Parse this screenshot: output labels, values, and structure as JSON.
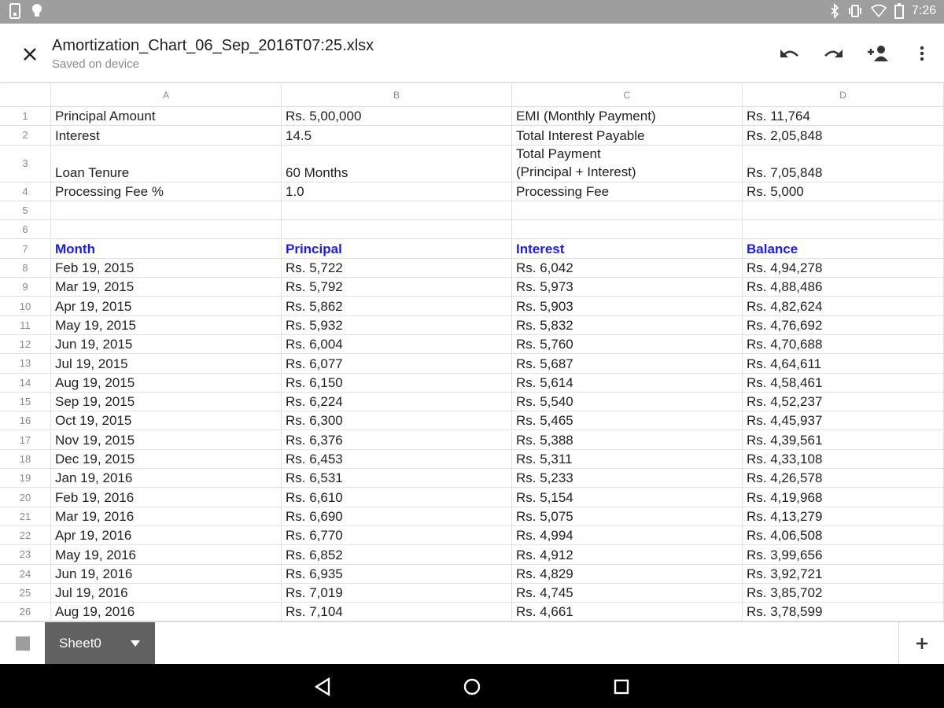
{
  "status_bar": {
    "time": "7:26",
    "left_icons": [
      "sim-icon",
      "lightbulb-icon"
    ],
    "right_icons": [
      "bluetooth-icon",
      "vibrate-icon",
      "wifi-icon",
      "battery-icon"
    ]
  },
  "app_bar": {
    "title": "Amortization_Chart_06_Sep_2016T07:25.xlsx",
    "subtitle": "Saved on device",
    "actions": [
      "undo-icon",
      "redo-icon",
      "add-person-icon",
      "more-vert-icon"
    ]
  },
  "columns": [
    "A",
    "B",
    "C",
    "D"
  ],
  "rows": [
    {
      "num": "1",
      "cells": [
        "Principal Amount",
        "Rs. 5,00,000",
        "EMI (Monthly Payment)",
        "Rs. 11,764"
      ]
    },
    {
      "num": "2",
      "cells": [
        "Interest",
        "14.5",
        "Total Interest Payable",
        "Rs. 2,05,848"
      ]
    },
    {
      "num": "3",
      "cells": [
        "Loan Tenure",
        "60 Months",
        "Total Payment",
        "Rs. 7,05,848"
      ],
      "c_line2": "(Principal + Interest)"
    },
    {
      "num": "4",
      "cells": [
        "Processing Fee %",
        "1.0",
        "Processing Fee",
        "Rs. 5,000"
      ]
    },
    {
      "num": "5",
      "cells": [
        "",
        "",
        "",
        ""
      ]
    },
    {
      "num": "6",
      "cells": [
        "",
        "",
        "",
        ""
      ]
    },
    {
      "num": "7",
      "cells": [
        "Month",
        "Principal",
        "Interest",
        "Balance"
      ],
      "header": true
    },
    {
      "num": "8",
      "cells": [
        "Feb 19, 2015",
        "Rs. 5,722",
        "Rs. 6,042",
        "Rs. 4,94,278"
      ]
    },
    {
      "num": "9",
      "cells": [
        "Mar 19, 2015",
        "Rs. 5,792",
        "Rs. 5,973",
        "Rs. 4,88,486"
      ]
    },
    {
      "num": "10",
      "cells": [
        "Apr 19, 2015",
        "Rs. 5,862",
        "Rs. 5,903",
        "Rs. 4,82,624"
      ]
    },
    {
      "num": "11",
      "cells": [
        "May 19, 2015",
        "Rs. 5,932",
        "Rs. 5,832",
        "Rs. 4,76,692"
      ]
    },
    {
      "num": "12",
      "cells": [
        "Jun 19, 2015",
        "Rs. 6,004",
        "Rs. 5,760",
        "Rs. 4,70,688"
      ]
    },
    {
      "num": "13",
      "cells": [
        "Jul 19, 2015",
        "Rs. 6,077",
        "Rs. 5,687",
        "Rs. 4,64,611"
      ]
    },
    {
      "num": "14",
      "cells": [
        "Aug 19, 2015",
        "Rs. 6,150",
        "Rs. 5,614",
        "Rs. 4,58,461"
      ]
    },
    {
      "num": "15",
      "cells": [
        "Sep 19, 2015",
        "Rs. 6,224",
        "Rs. 5,540",
        "Rs. 4,52,237"
      ]
    },
    {
      "num": "16",
      "cells": [
        "Oct 19, 2015",
        "Rs. 6,300",
        "Rs. 5,465",
        "Rs. 4,45,937"
      ]
    },
    {
      "num": "17",
      "cells": [
        "Nov 19, 2015",
        "Rs. 6,376",
        "Rs. 5,388",
        "Rs. 4,39,561"
      ]
    },
    {
      "num": "18",
      "cells": [
        "Dec 19, 2015",
        "Rs. 6,453",
        "Rs. 5,311",
        "Rs. 4,33,108"
      ]
    },
    {
      "num": "19",
      "cells": [
        "Jan 19, 2016",
        "Rs. 6,531",
        "Rs. 5,233",
        "Rs. 4,26,578"
      ]
    },
    {
      "num": "20",
      "cells": [
        "Feb 19, 2016",
        "Rs. 6,610",
        "Rs. 5,154",
        "Rs. 4,19,968"
      ]
    },
    {
      "num": "21",
      "cells": [
        "Mar 19, 2016",
        "Rs. 6,690",
        "Rs. 5,075",
        "Rs. 4,13,279"
      ]
    },
    {
      "num": "22",
      "cells": [
        "Apr 19, 2016",
        "Rs. 6,770",
        "Rs. 4,994",
        "Rs. 4,06,508"
      ]
    },
    {
      "num": "23",
      "cells": [
        "May 19, 2016",
        "Rs. 6,852",
        "Rs. 4,912",
        "Rs. 3,99,656"
      ]
    },
    {
      "num": "24",
      "cells": [
        "Jun 19, 2016",
        "Rs. 6,935",
        "Rs. 4,829",
        "Rs. 3,92,721"
      ]
    },
    {
      "num": "25",
      "cells": [
        "Jul 19, 2016",
        "Rs. 7,019",
        "Rs. 4,745",
        "Rs. 3,85,702"
      ]
    },
    {
      "num": "26",
      "cells": [
        "Aug 19, 2016",
        "Rs. 7,104",
        "Rs. 4,661",
        "Rs. 3,78,599"
      ]
    }
  ],
  "bottom_bar": {
    "sheet_tab": "Sheet0",
    "add_icon": "add-sheet-icon",
    "toggle_icon": "sheets-list-icon"
  },
  "nav_bar": [
    "back-icon",
    "home-icon",
    "recents-icon"
  ],
  "colors": {
    "header_text": "#1a1aff",
    "status_bar": "#9e9e9e",
    "sheet_tab": "#616161"
  }
}
